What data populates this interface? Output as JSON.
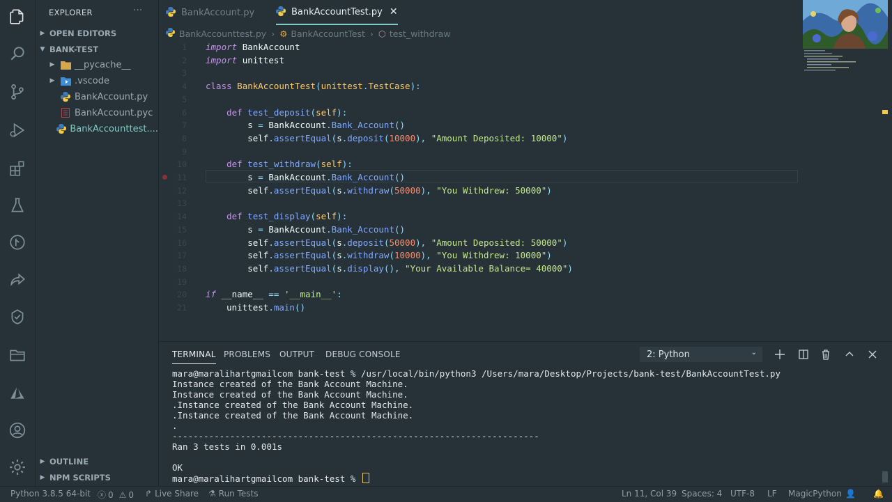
{
  "sidebar": {
    "title": "EXPLORER",
    "more": "···",
    "open_editors": "OPEN EDITORS",
    "project": "BANK-TEST",
    "items": [
      {
        "name": "__pycache__",
        "type": "folder"
      },
      {
        "name": ".vscode",
        "type": "folder"
      },
      {
        "name": "BankAccount.py",
        "type": "python"
      },
      {
        "name": "BankAccount.pyc",
        "type": "pyc"
      },
      {
        "name": "BankAccounttest....",
        "type": "python",
        "active": true
      }
    ],
    "outline": "OUTLINE",
    "npm_scripts": "NPM SCRIPTS"
  },
  "tabs": [
    {
      "label": "BankAccount.py",
      "active": false
    },
    {
      "label": "BankAccountTest.py",
      "active": true,
      "close": "✕"
    }
  ],
  "breadcrumbs": [
    "BankAccounttest.py",
    "BankAccountTest",
    "test_withdraw"
  ],
  "editor": {
    "lines": [
      {
        "n": "1",
        "code": "<span class=\"kw\">import</span> <span class=\"plain\">BankAccount</span>"
      },
      {
        "n": "2",
        "code": "<span class=\"kw\">import</span> <span class=\"plain\">unittest</span>"
      },
      {
        "n": "3",
        "code": ""
      },
      {
        "n": "4",
        "code": "<span class=\"kd\">class</span> <span class=\"cls\">BankAccountTest</span><span class=\"punc\">(</span><span class=\"cls\">unittest</span><span class=\"punc\">.</span><span class=\"cls\">TestCase</span><span class=\"punc\">):</span>"
      },
      {
        "n": "5",
        "code": ""
      },
      {
        "n": "6",
        "code": "    <span class=\"kd\">def</span> <span class=\"fn\">test_deposit</span><span class=\"punc\">(</span><span class=\"cls\">self</span><span class=\"punc\">):</span>"
      },
      {
        "n": "7",
        "code": "        <span class=\"plain\">s</span> <span class=\"punc\">=</span> <span class=\"plain\">BankAccount</span><span class=\"punc\">.</span><span class=\"fn\">Bank_Account</span><span class=\"punc\">()</span>"
      },
      {
        "n": "8",
        "code": "        <span class=\"plain\">self</span><span class=\"punc\">.</span><span class=\"fn\">assertEqual</span><span class=\"punc\">(</span><span class=\"plain\">s</span><span class=\"punc\">.</span><span class=\"fn\">deposit</span><span class=\"punc\">(</span><span class=\"num\">10000</span><span class=\"punc\">),</span> <span class=\"str\">\"Amount Deposited: 10000\"</span><span class=\"punc\">)</span>"
      },
      {
        "n": "9",
        "code": ""
      },
      {
        "n": "10",
        "code": "    <span class=\"kd\">def</span> <span class=\"fn\">test_withdraw</span><span class=\"punc\">(</span><span class=\"cls\">self</span><span class=\"punc\">):</span>"
      },
      {
        "n": "11",
        "code": "        <span class=\"plain\">s</span> <span class=\"punc\">=</span> <span class=\"plain\">BankAccount</span><span class=\"punc\">.</span><span class=\"fn\">Bank_Account</span><span class=\"punc\">()</span>"
      },
      {
        "n": "12",
        "code": "        <span class=\"plain\">self</span><span class=\"punc\">.</span><span class=\"fn\">assertEqual</span><span class=\"punc\">(</span><span class=\"plain\">s</span><span class=\"punc\">.</span><span class=\"fn\">withdraw</span><span class=\"punc\">(</span><span class=\"num\">50000</span><span class=\"punc\">),</span> <span class=\"str\">\"You Withdrew: 50000\"</span><span class=\"punc\">)</span>"
      },
      {
        "n": "13",
        "code": ""
      },
      {
        "n": "14",
        "code": "    <span class=\"kd\">def</span> <span class=\"fn\">test_display</span><span class=\"punc\">(</span><span class=\"cls\">self</span><span class=\"punc\">):</span>"
      },
      {
        "n": "15",
        "code": "        <span class=\"plain\">s</span> <span class=\"punc\">=</span> <span class=\"plain\">BankAccount</span><span class=\"punc\">.</span><span class=\"fn\">Bank_Account</span><span class=\"punc\">()</span>"
      },
      {
        "n": "16",
        "code": "        <span class=\"plain\">self</span><span class=\"punc\">.</span><span class=\"fn\">assertEqual</span><span class=\"punc\">(</span><span class=\"plain\">s</span><span class=\"punc\">.</span><span class=\"fn\">deposit</span><span class=\"punc\">(</span><span class=\"num\">50000</span><span class=\"punc\">),</span> <span class=\"str\">\"Amount Deposited: 50000\"</span><span class=\"punc\">)</span>"
      },
      {
        "n": "17",
        "code": "        <span class=\"plain\">self</span><span class=\"punc\">.</span><span class=\"fn\">assertEqual</span><span class=\"punc\">(</span><span class=\"plain\">s</span><span class=\"punc\">.</span><span class=\"fn\">withdraw</span><span class=\"punc\">(</span><span class=\"num\">10000</span><span class=\"punc\">),</span> <span class=\"str\">\"You Withdrew: 10000\"</span><span class=\"punc\">)</span>"
      },
      {
        "n": "18",
        "code": "        <span class=\"plain\">self</span><span class=\"punc\">.</span><span class=\"fn\">assertEqual</span><span class=\"punc\">(</span><span class=\"plain\">s</span><span class=\"punc\">.</span><span class=\"fn\">display</span><span class=\"punc\">(),</span> <span class=\"str\">\"Your Available Balance= 40000\"</span><span class=\"punc\">)</span>"
      },
      {
        "n": "19",
        "code": ""
      },
      {
        "n": "20",
        "code": "<span class=\"kw\">if</span> <span class=\"plain\">__name__</span> <span class=\"punc\">==</span> <span class=\"str\">'__main__'</span><span class=\"punc\">:</span>"
      },
      {
        "n": "21",
        "code": "    <span class=\"plain\">unittest</span><span class=\"punc\">.</span><span class=\"fn\">main</span><span class=\"punc\">()</span>"
      }
    ]
  },
  "panel": {
    "tabs": [
      "TERMINAL",
      "PROBLEMS",
      "OUTPUT",
      "DEBUG CONSOLE"
    ],
    "terminal_select": "2: Python",
    "terminal_lines": [
      "mara@maralihartgmailcom bank-test % /usr/local/bin/python3 /Users/mara/Desktop/Projects/bank-test/BankAccountTest.py",
      "Instance created of the Bank Account Machine.",
      "Instance created of the Bank Account Machine.",
      ".Instance created of the Bank Account Machine.",
      ".Instance created of the Bank Account Machine.",
      ".",
      "----------------------------------------------------------------------",
      "Ran 3 tests in 0.001s",
      "",
      "OK"
    ],
    "prompt": "mara@maralihartgmailcom bank-test % "
  },
  "status": {
    "python": "Python 3.8.5 64-bit",
    "errors": "0",
    "warnings": "0",
    "live_share": "Live Share",
    "run_tests": "Run Tests",
    "position": "Ln 11, Col 39",
    "spaces": "Spaces: 4",
    "encoding": "UTF-8",
    "eol": "LF",
    "language": "MagicPython"
  },
  "colors": {
    "background": "#263238",
    "accent": "#80cbc4",
    "keyword": "#c792ea",
    "class": "#ffcb6b",
    "function": "#82aaff",
    "string": "#c3e88d",
    "number": "#f78c6c"
  }
}
